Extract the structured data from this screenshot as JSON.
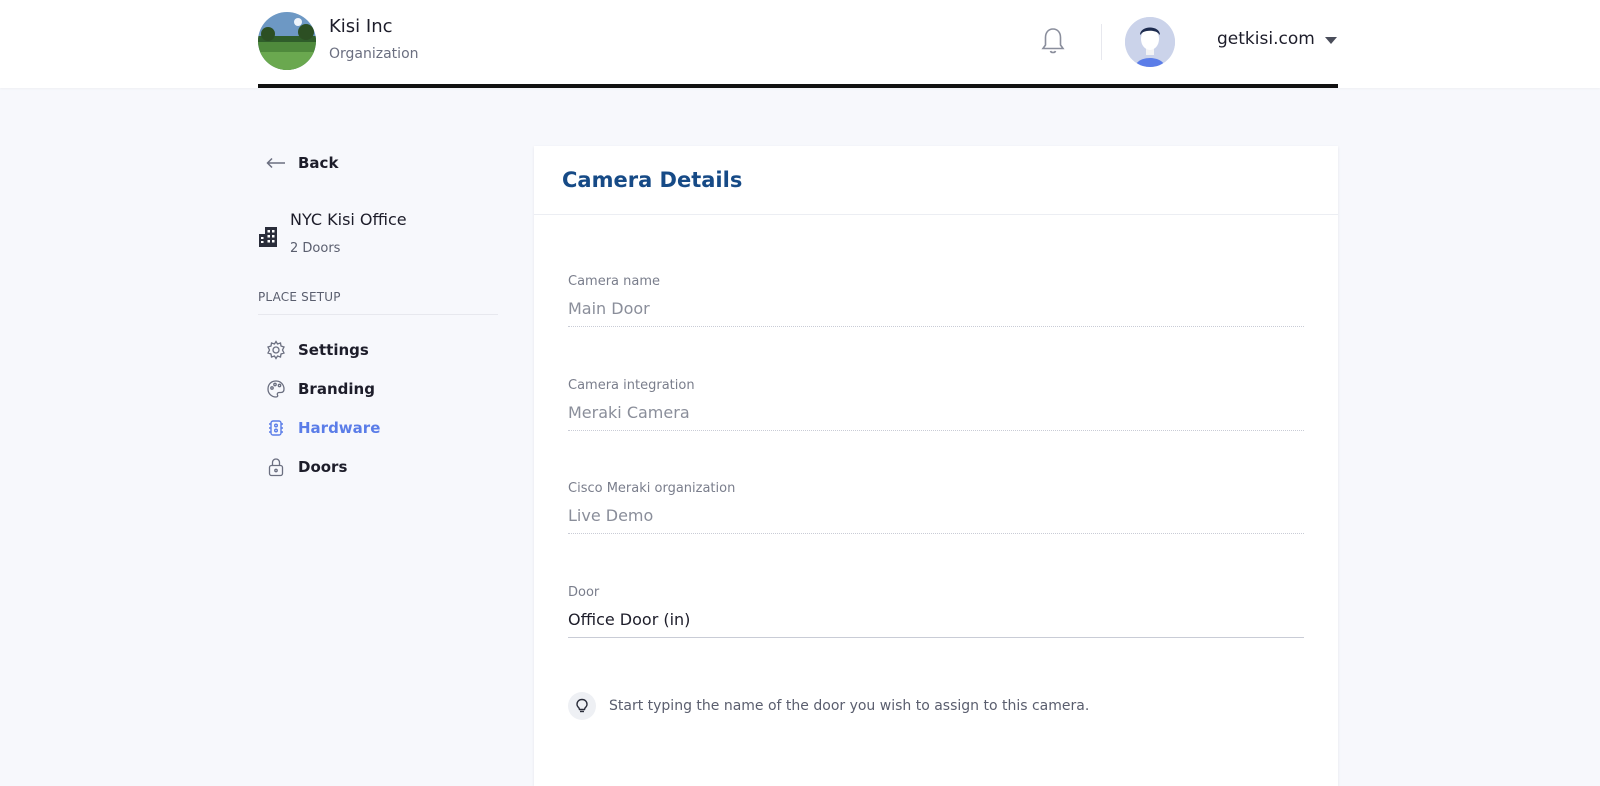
{
  "header": {
    "org_name": "Kisi Inc",
    "org_subtitle": "Organization",
    "account_label": "getkisi.com"
  },
  "sidebar": {
    "back_label": "Back",
    "place_name": "NYC Kisi Office",
    "place_doors": "2 Doors",
    "section_label": "PLACE SETUP",
    "items": [
      {
        "label": "Settings",
        "icon": "gear-icon"
      },
      {
        "label": "Branding",
        "icon": "palette-icon"
      },
      {
        "label": "Hardware",
        "icon": "chip-icon",
        "active": true
      },
      {
        "label": "Doors",
        "icon": "lock-icon"
      }
    ]
  },
  "card": {
    "title": "Camera Details",
    "fields": [
      {
        "label": "Camera name",
        "value": "Main Door"
      },
      {
        "label": "Camera integration",
        "value": "Meraki Camera"
      },
      {
        "label": "Cisco Meraki organization",
        "value": "Live Demo"
      },
      {
        "label": "Door",
        "value": "Office Door (in)"
      }
    ],
    "hint": "Start typing the name of the door you wish to assign to this camera."
  },
  "colors": {
    "accent": "#5b7de8",
    "title": "#164a86",
    "background": "#f7f8fc"
  }
}
